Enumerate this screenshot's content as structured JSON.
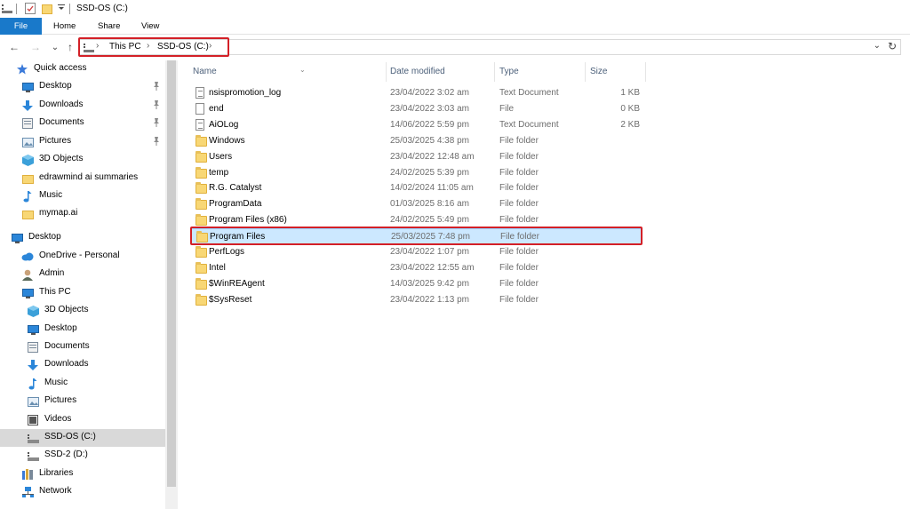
{
  "window": {
    "title": "SSD-OS (C:)",
    "quick_access_icons": [
      "drive-icon",
      "properties-checkbox-icon",
      "new-folder-icon",
      "customize-dropdown-icon"
    ]
  },
  "ribbon": {
    "tabs": [
      {
        "label": "File",
        "active": true
      },
      {
        "label": "Home"
      },
      {
        "label": "Share"
      },
      {
        "label": "View"
      }
    ],
    "accent": "#1979ca"
  },
  "nav": {
    "back": "←",
    "forward": "→",
    "recent": "⌄",
    "up": "↑"
  },
  "address": {
    "breadcrumbs": [
      "This PC",
      "SSD-OS (C:)"
    ],
    "highlight_color": "#d32027"
  },
  "navpane": {
    "items": [
      {
        "label": "Quick access",
        "icon": "star-icon"
      },
      {
        "label": "Desktop",
        "icon": "desktop-icon",
        "pinned": true
      },
      {
        "label": "Downloads",
        "icon": "download-arrow-icon",
        "pinned": true
      },
      {
        "label": "Documents",
        "icon": "documents-icon",
        "pinned": true
      },
      {
        "label": "Pictures",
        "icon": "pictures-icon",
        "pinned": true
      },
      {
        "label": "3D Objects",
        "icon": "cube-icon"
      },
      {
        "label": "edrawmind ai summaries",
        "icon": "folder-icon"
      },
      {
        "label": "Music",
        "icon": "music-note-icon"
      },
      {
        "label": "mymap.ai",
        "icon": "folder-icon"
      },
      {
        "label": "Desktop",
        "icon": "desktop-icon"
      },
      {
        "label": "OneDrive - Personal",
        "icon": "cloud-icon"
      },
      {
        "label": "Admin",
        "icon": "user-icon"
      },
      {
        "label": "This PC",
        "icon": "computer-icon"
      },
      {
        "label": "3D Objects",
        "icon": "cube-icon"
      },
      {
        "label": "Desktop",
        "icon": "desktop-icon"
      },
      {
        "label": "Documents",
        "icon": "documents-icon"
      },
      {
        "label": "Downloads",
        "icon": "download-arrow-icon"
      },
      {
        "label": "Music",
        "icon": "music-note-icon"
      },
      {
        "label": "Pictures",
        "icon": "pictures-icon"
      },
      {
        "label": "Videos",
        "icon": "video-icon"
      },
      {
        "label": "SSD-OS (C:)",
        "icon": "drive-icon",
        "selected": true
      },
      {
        "label": "SSD-2 (D:)",
        "icon": "drive-icon"
      },
      {
        "label": "Libraries",
        "icon": "library-icon"
      },
      {
        "label": "Network",
        "icon": "network-icon"
      }
    ],
    "pin_glyph": "📌"
  },
  "columns": {
    "name": "Name",
    "date": "Date modified",
    "type": "Type",
    "size": "Size"
  },
  "files": [
    {
      "name": "nsispromotion_log",
      "date": "23/04/2022 3:02 am",
      "type": "Text Document",
      "size": "1 KB",
      "icon": "text-file-icon"
    },
    {
      "name": "end",
      "date": "23/04/2022 3:03 am",
      "type": "File",
      "size": "0 KB",
      "icon": "file-icon"
    },
    {
      "name": "AiOLog",
      "date": "14/06/2022 5:59 pm",
      "type": "Text Document",
      "size": "2 KB",
      "icon": "text-file-icon"
    },
    {
      "name": "Windows",
      "date": "25/03/2025 4:38 pm",
      "type": "File folder",
      "size": "",
      "icon": "folder-icon"
    },
    {
      "name": "Users",
      "date": "23/04/2022 12:48 am",
      "type": "File folder",
      "size": "",
      "icon": "folder-icon"
    },
    {
      "name": "temp",
      "date": "24/02/2025 5:39 pm",
      "type": "File folder",
      "size": "",
      "icon": "folder-icon"
    },
    {
      "name": "R.G. Catalyst",
      "date": "14/02/2024 11:05 am",
      "type": "File folder",
      "size": "",
      "icon": "folder-icon"
    },
    {
      "name": "ProgramData",
      "date": "01/03/2025 8:16 am",
      "type": "File folder",
      "size": "",
      "icon": "folder-icon"
    },
    {
      "name": "Program Files (x86)",
      "date": "24/02/2025 5:49 pm",
      "type": "File folder",
      "size": "",
      "icon": "folder-icon"
    },
    {
      "name": "Program Files",
      "date": "25/03/2025 7:48 pm",
      "type": "File folder",
      "size": "",
      "icon": "folder-icon",
      "selected": true
    },
    {
      "name": "PerfLogs",
      "date": "23/04/2022 1:07 pm",
      "type": "File folder",
      "size": "",
      "icon": "folder-icon"
    },
    {
      "name": "Intel",
      "date": "23/04/2022 12:55 am",
      "type": "File folder",
      "size": "",
      "icon": "folder-icon"
    },
    {
      "name": "$WinREAgent",
      "date": "14/03/2025 9:42 pm",
      "type": "File folder",
      "size": "",
      "icon": "folder-icon"
    },
    {
      "name": "$SysReset",
      "date": "23/04/2022 1:13 pm",
      "type": "File folder",
      "size": "",
      "icon": "folder-icon"
    }
  ]
}
